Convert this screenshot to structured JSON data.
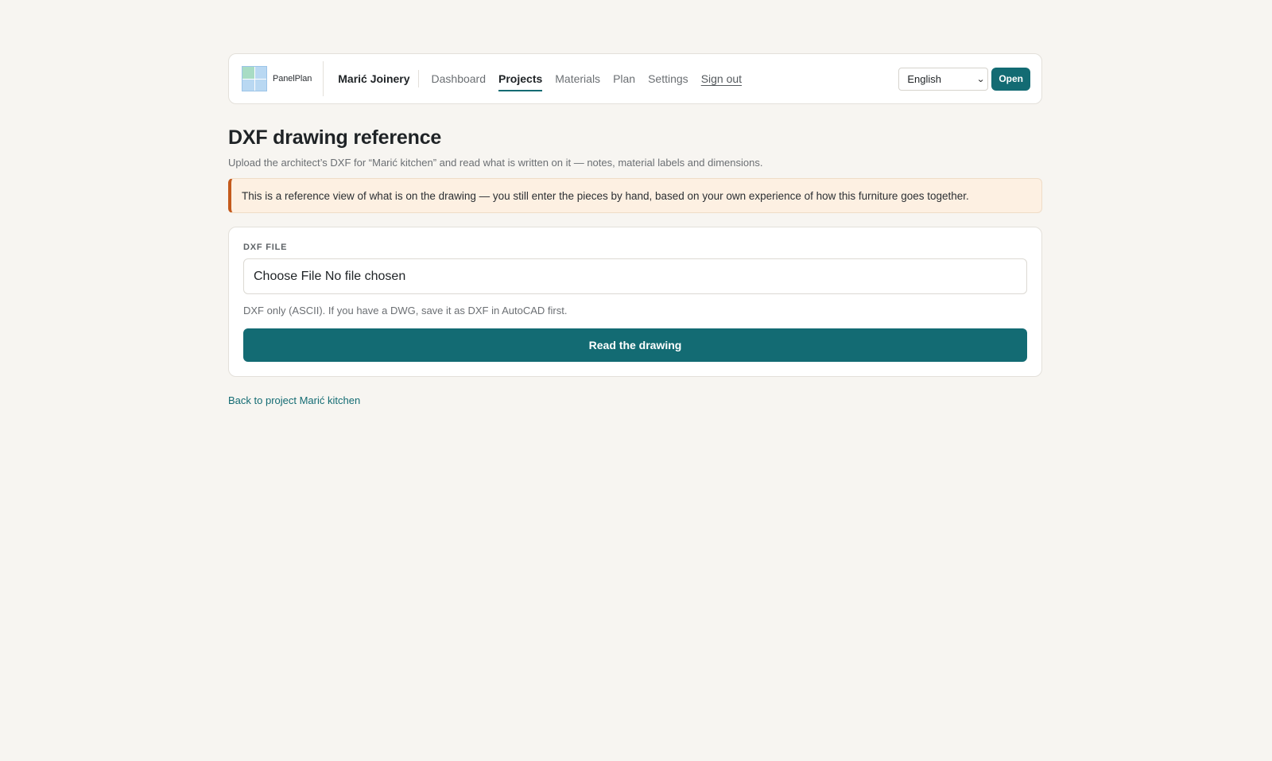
{
  "header": {
    "brand_name": "PanelPlan",
    "organization": "Marić Joinery",
    "nav": [
      {
        "label": "Dashboard"
      },
      {
        "label": "Projects"
      },
      {
        "label": "Materials"
      },
      {
        "label": "Plan"
      },
      {
        "label": "Settings"
      },
      {
        "label": "Sign out"
      }
    ],
    "active_nav": "Projects",
    "language": {
      "selected": "English"
    },
    "open_label": "Open"
  },
  "page": {
    "title": "DXF drawing reference",
    "subtitle": "Upload the architect’s DXF for “Marić kitchen” and read what is written on it — notes, material labels and dimensions.",
    "notice": "This is a reference view of what is on the drawing — you still enter the pieces by hand, based on your own experience of how this furniture goes together."
  },
  "form": {
    "field_label": "DXF FILE",
    "file_input_text": "Choose File No file chosen",
    "hint": "DXF only (ASCII). If you have a DWG, save it as DXF in AutoCAD first.",
    "submit_label": "Read the drawing"
  },
  "back_link": "Back to project Marić kitchen",
  "colors": {
    "accent": "#136b73",
    "notice_border": "#c45a1c",
    "notice_bg": "#fdf0e2",
    "background": "#f7f5f1"
  },
  "icons": {
    "logo": "panelplan-logo-icon",
    "select_chevron": "chevron-down-icon"
  }
}
